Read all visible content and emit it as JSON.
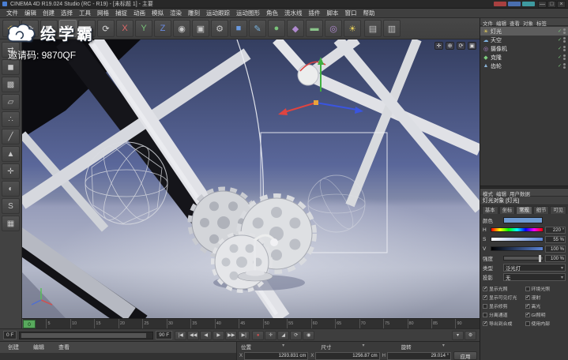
{
  "title_bar": {
    "title": "CINEMA 4D R19.024 Studio (RC - R19) - [未标题 1] - 主要",
    "app_icon_color": "#4a7fd4",
    "chips": [
      {
        "name": "overlay-chip-red",
        "bg": "#a84040"
      },
      {
        "name": "overlay-chip-blue",
        "bg": "#4a6fb0"
      },
      {
        "name": "overlay-chip-teal",
        "bg": "#3e9aa0"
      }
    ],
    "window_buttons": [
      {
        "name": "minimize-button",
        "glyph": "—"
      },
      {
        "name": "maximize-button",
        "glyph": "□"
      },
      {
        "name": "close-button",
        "glyph": "×"
      }
    ]
  },
  "menu_bar": {
    "items": [
      "文件",
      "编辑",
      "创建",
      "选择",
      "工具",
      "网格",
      "捕捉",
      "动画",
      "模拟",
      "渲染",
      "雕刻",
      "运动跟踪",
      "运动图形",
      "角色",
      "流水线",
      "插件",
      "脚本",
      "窗口",
      "帮助"
    ]
  },
  "toolbar": {
    "icons": [
      {
        "name": "undo-icon",
        "glyph": "↶",
        "color": "#e3c05a"
      },
      {
        "name": "redo-icon",
        "glyph": "↷",
        "color": "#c0c4cc"
      },
      {
        "name": "select-tool-icon",
        "glyph": "◤",
        "color": "#d8d8d8"
      },
      {
        "name": "move-tool-icon",
        "glyph": "✛",
        "color": "#e8e8e8",
        "active": true
      },
      {
        "name": "scale-tool-icon",
        "glyph": "◢",
        "color": "#d8d8d8"
      },
      {
        "name": "rotate-tool-icon",
        "glyph": "⟳",
        "color": "#d8d8d8"
      },
      {
        "name": "axis-x-icon",
        "glyph": "X",
        "color": "#e06a6a"
      },
      {
        "name": "axis-y-icon",
        "glyph": "Y",
        "color": "#7ac47a"
      },
      {
        "name": "axis-z-icon",
        "glyph": "Z",
        "color": "#6a8ae0"
      },
      {
        "name": "coord-system-icon",
        "glyph": "◉",
        "color": "#c8c8c8"
      },
      {
        "name": "render-view-icon",
        "glyph": "▣",
        "color": "#c8c8c8"
      },
      {
        "name": "render-settings-icon",
        "glyph": "⚙",
        "color": "#c8c8c8"
      },
      {
        "name": "primitive-cube-icon",
        "glyph": "■",
        "color": "#6a9ae0"
      },
      {
        "name": "spline-pen-icon",
        "glyph": "✎",
        "color": "#7ab4e0"
      },
      {
        "name": "subdivision-surface-icon",
        "glyph": "●",
        "color": "#7ac47a"
      },
      {
        "name": "array-generator-icon",
        "glyph": "◆",
        "color": "#b08ad0"
      },
      {
        "name": "floor-object-icon",
        "glyph": "▬",
        "color": "#8ac48a"
      },
      {
        "name": "camera-object-icon",
        "glyph": "◎",
        "color": "#b08ad0"
      },
      {
        "name": "light-object-icon",
        "glyph": "☀",
        "color": "#e8d05a"
      }
    ],
    "right_icons": [
      {
        "name": "layout-single-icon",
        "glyph": "▤",
        "color": "#c0c0c0"
      },
      {
        "name": "layout-quad-icon",
        "glyph": "▥",
        "color": "#c0c0c0"
      }
    ]
  },
  "left_toolbar": {
    "icons": [
      {
        "name": "convert-icon",
        "glyph": "⇄"
      },
      {
        "name": "model-mode-icon",
        "glyph": "◼"
      },
      {
        "name": "texture-mode-icon",
        "glyph": "▩"
      },
      {
        "name": "workplane-icon",
        "glyph": "▱"
      },
      {
        "name": "points-mode-icon",
        "glyph": "∴"
      },
      {
        "name": "edges-mode-icon",
        "glyph": "╱"
      },
      {
        "name": "polygons-mode-icon",
        "glyph": "▲"
      },
      {
        "name": "axis-modify-icon",
        "glyph": "✛"
      },
      {
        "name": "viewport-solo-icon",
        "glyph": "◐"
      },
      {
        "name": "snap-icon",
        "glyph": "S"
      },
      {
        "name": "workplane-lock-icon",
        "glyph": "▦"
      }
    ]
  },
  "watermark": {
    "brand": "绘学霸",
    "invite": "邀请码: 9870QF"
  },
  "viewport": {
    "view_icons": [
      {
        "name": "pan-view-icon",
        "glyph": "✛"
      },
      {
        "name": "zoom-view-icon",
        "glyph": "⊕"
      },
      {
        "name": "rotate-view-icon",
        "glyph": "⟳"
      },
      {
        "name": "toggle-panel-icon",
        "glyph": "▣"
      }
    ]
  },
  "timeline": {
    "current": "0",
    "ticks": [
      "0",
      "5",
      "10",
      "15",
      "20",
      "25",
      "30",
      "35",
      "40",
      "45",
      "50",
      "55",
      "60",
      "65",
      "70",
      "75",
      "80",
      "85",
      "90"
    ]
  },
  "transport": {
    "start_frame": "0 F",
    "end_frame": "90 F",
    "buttons": [
      {
        "name": "goto-start-button",
        "glyph": "|◀"
      },
      {
        "name": "prev-key-button",
        "glyph": "◀◀"
      },
      {
        "name": "prev-frame-button",
        "glyph": "◀"
      },
      {
        "name": "play-button",
        "glyph": "▶"
      },
      {
        "name": "next-frame-button",
        "glyph": "▶▶"
      },
      {
        "name": "goto-end-button",
        "glyph": "▶|"
      }
    ],
    "record_buttons": [
      {
        "name": "record-keyframe-button",
        "glyph": "●",
        "color": "#d05050"
      },
      {
        "name": "record-position-button",
        "glyph": "✛"
      },
      {
        "name": "record-scale-button",
        "glyph": "◢"
      },
      {
        "name": "record-rotation-button",
        "glyph": "⟳"
      },
      {
        "name": "autokey-button",
        "glyph": "◉"
      }
    ],
    "right_icons": [
      {
        "name": "playback-options-icon",
        "glyph": "▾"
      },
      {
        "name": "timeline-options-icon",
        "glyph": "⚙"
      }
    ]
  },
  "materials_panel": {
    "menus": [
      "创建",
      "编辑",
      "查看"
    ]
  },
  "coordinates_panel": {
    "groups": [
      {
        "label": "位置",
        "axis": "X",
        "value": "1293.831 cm"
      },
      {
        "label": "尺寸",
        "axis": "X",
        "value": "1256.87 cm"
      },
      {
        "label": "旋转",
        "axis": "H",
        "value": "29.014 °"
      }
    ],
    "apply_label": "应用"
  },
  "object_manager": {
    "menus": [
      "文件",
      "编辑",
      "查看",
      "对象",
      "标签"
    ],
    "objects": [
      {
        "name": "灯光",
        "glyph": "☀",
        "color": "#e8d05a",
        "selected": true
      },
      {
        "name": "天空",
        "glyph": "☁",
        "color": "#7fb2e0"
      },
      {
        "name": "摄像机",
        "glyph": "◎",
        "color": "#b48ad0"
      },
      {
        "name": "克隆",
        "glyph": "◆",
        "color": "#7fd07f"
      },
      {
        "name": "齿轮",
        "glyph": "▲",
        "color": "#8ab4d8"
      }
    ]
  },
  "attributes": {
    "menus": [
      "模式",
      "编辑",
      "用户数据"
    ],
    "title": "灯光对象 [灯光]",
    "tabs": [
      {
        "label": "基本"
      },
      {
        "label": "坐标"
      },
      {
        "label": "常规",
        "active": true
      },
      {
        "label": "细节"
      },
      {
        "label": "可见"
      }
    ],
    "color_label": "颜色",
    "color_hex": "#6f9ad0",
    "sliders": {
      "h": {
        "label": "H",
        "value": "220 °"
      },
      "s": {
        "label": "S",
        "value": "55 %"
      },
      "v": {
        "label": "V",
        "value": "100 %"
      }
    },
    "intensity_label": "强度",
    "intensity_value": "100 %",
    "type_label": "类型",
    "type_value": "泛光灯",
    "shadow_label": "投影",
    "shadow_value": "无",
    "checkboxes": [
      {
        "label": "显示光照",
        "checked": true
      },
      {
        "label": "环境光照",
        "checked": false
      },
      {
        "label": "显示可见灯光",
        "checked": true
      },
      {
        "label": "漫射",
        "checked": true
      },
      {
        "label": "显示修剪",
        "checked": false
      },
      {
        "label": "高光",
        "checked": true
      },
      {
        "label": "分离通道",
        "checked": false
      },
      {
        "label": "GI照明",
        "checked": true
      },
      {
        "label": "导出到合成",
        "checked": true
      },
      {
        "label": "使用内部",
        "checked": false
      }
    ]
  }
}
